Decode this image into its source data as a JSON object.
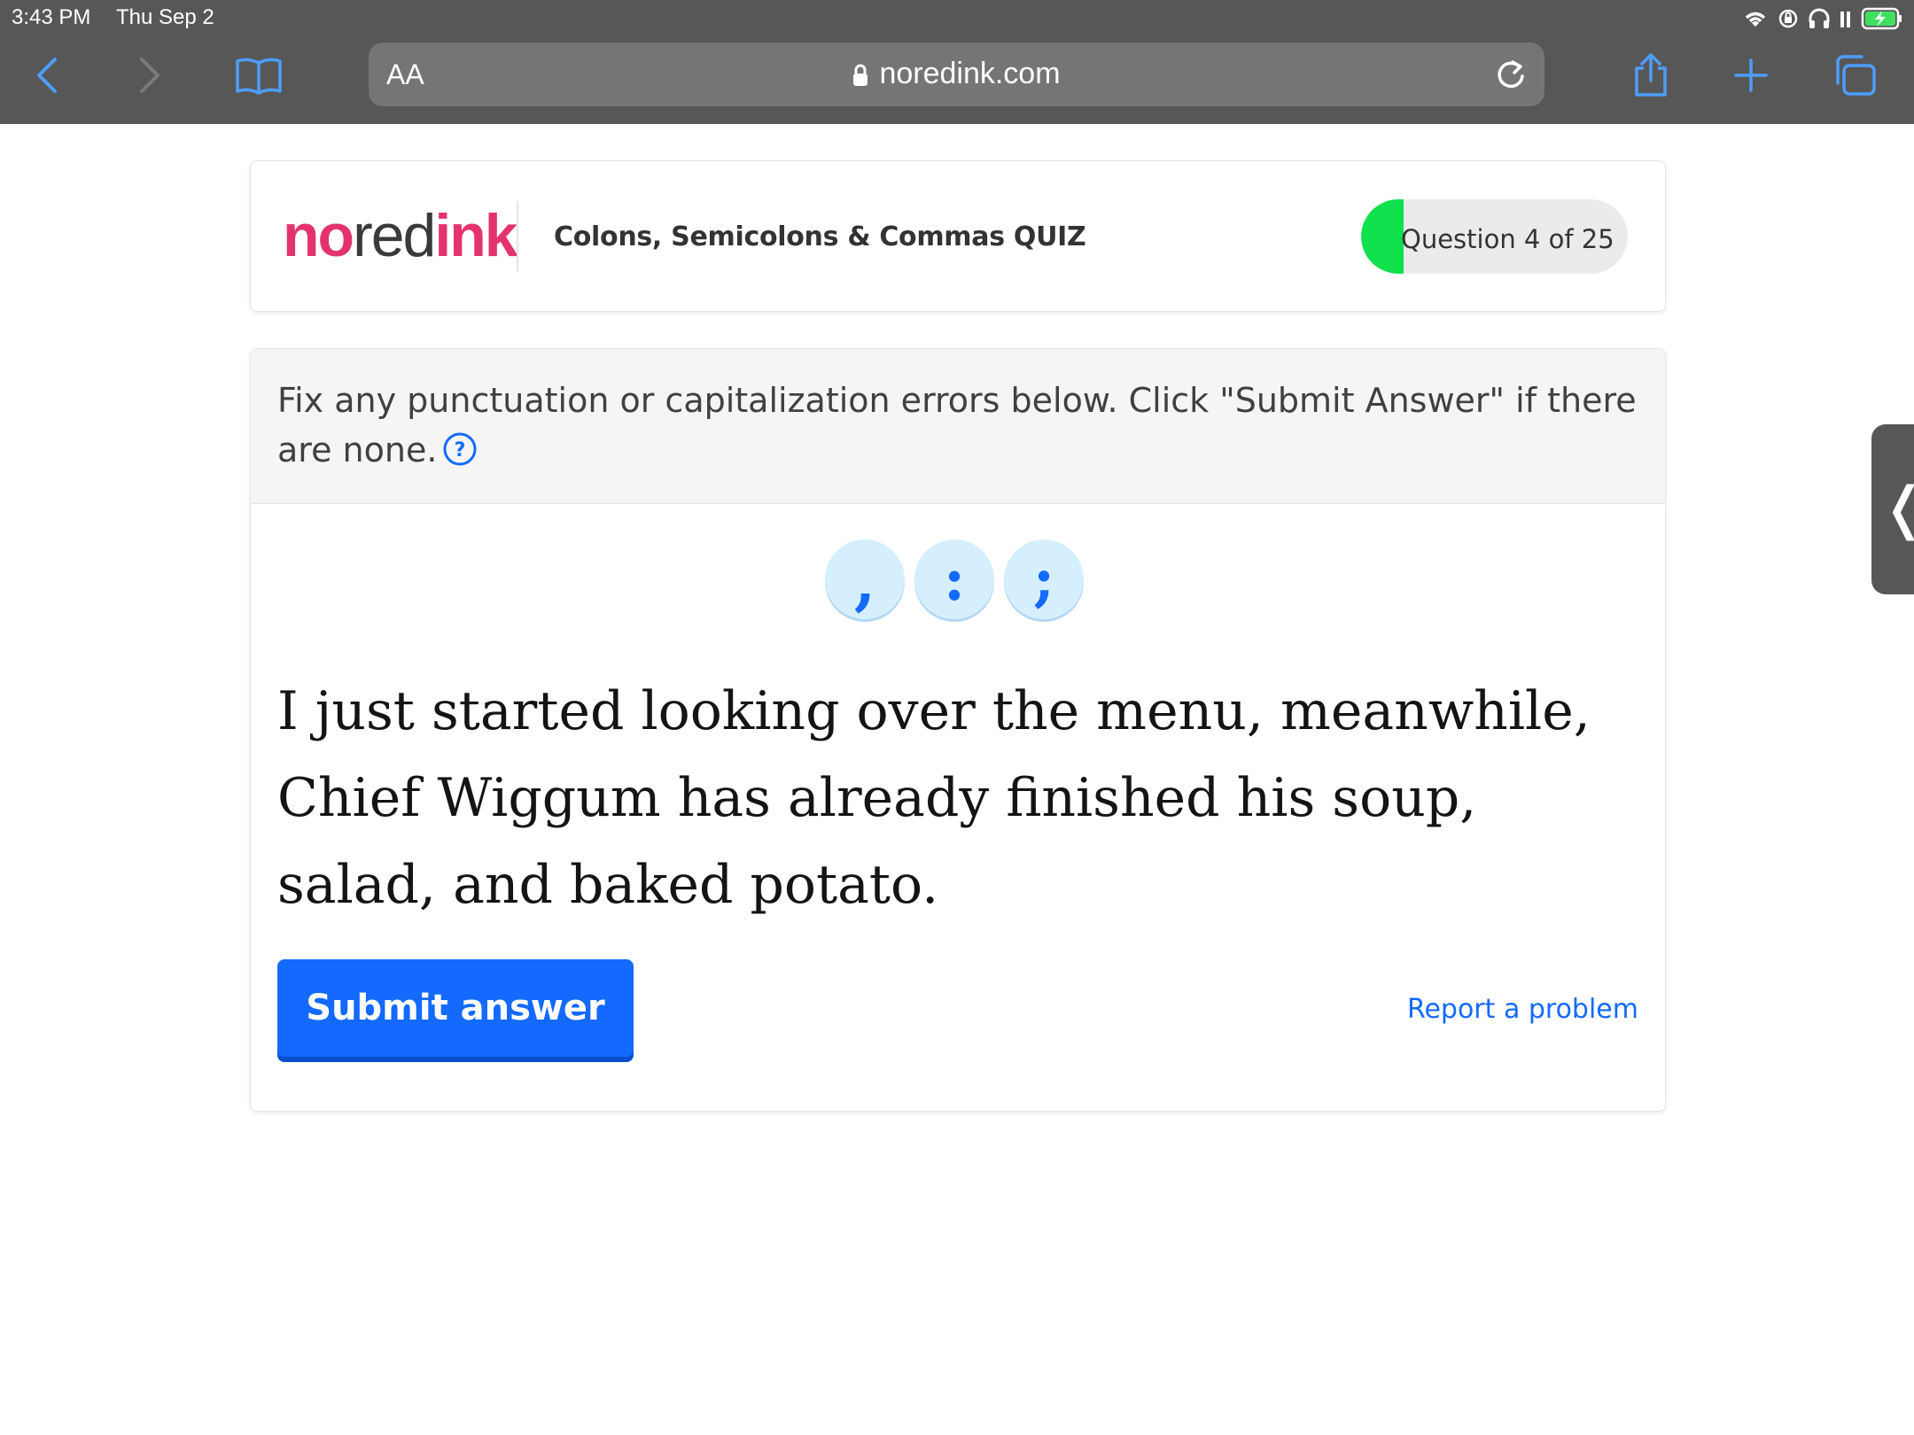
{
  "status_bar": {
    "time": "3:43 PM",
    "date": "Thu Sep 2"
  },
  "browser": {
    "text_size_label": "AA",
    "url": "noredink.com",
    "icons": [
      "back-icon",
      "forward-icon",
      "bookmarks-icon",
      "lock-icon",
      "reload-icon",
      "share-icon",
      "new-tab-icon",
      "tabs-icon"
    ]
  },
  "header": {
    "logo_part1": "no",
    "logo_part2": "red",
    "logo_part3": "ink",
    "quiz_title": "Colons, Semicolons & Commas QUIZ",
    "progress_text": "Question 4 of 25",
    "progress_current": 4,
    "progress_total": 25
  },
  "quiz": {
    "instructions": "Fix any punctuation or capitalization errors below. Click \"Submit Answer\" if there are none.",
    "punctuation_buttons": [
      ",",
      ":",
      ";"
    ],
    "sentence": "I just started looking over the menu, meanwhile, Chief Wiggum has already finished his soup, salad, and baked potato.",
    "submit_label": "Submit answer",
    "report_label": "Report a problem"
  },
  "side_tab": {
    "glyph": "❬"
  },
  "colors": {
    "brand_pink": "#e3336f",
    "primary_blue": "#146aff",
    "progress_green": "#0fe14d",
    "browser_chrome": "#575757"
  }
}
